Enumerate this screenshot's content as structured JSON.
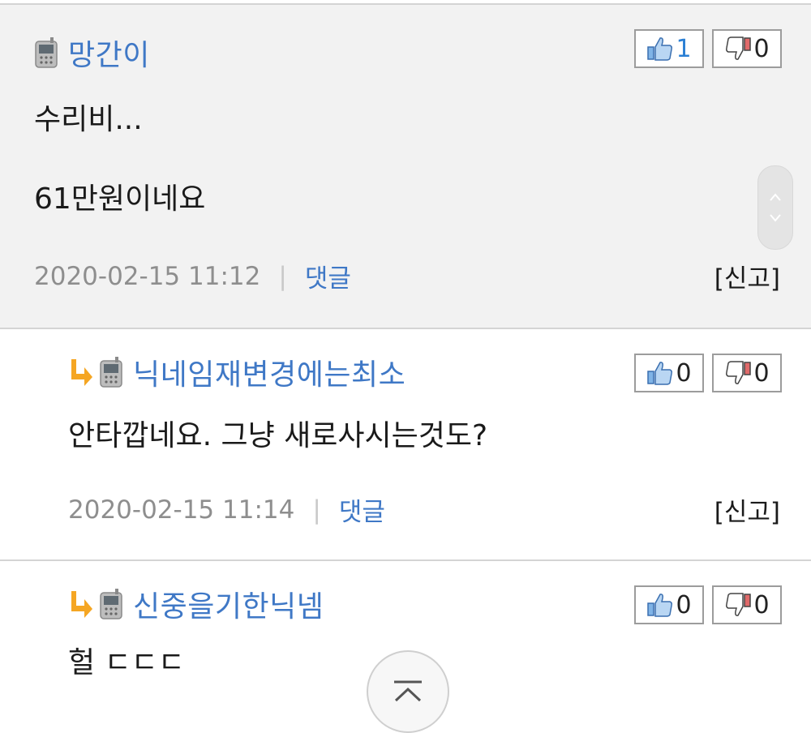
{
  "comments": [
    {
      "nickname": "망간이",
      "lines": [
        "수리비...",
        "61만원이네요"
      ],
      "date": "2020-02-15 11:12",
      "separator": "|",
      "reply_label": "댓글",
      "report_label": "[신고]",
      "likes": "1",
      "dislikes": "0"
    },
    {
      "nickname": "닉네임재변경에는최소",
      "lines": [
        "안타깝네요. 그냥 새로사시는것도?"
      ],
      "date": "2020-02-15 11:14",
      "separator": "|",
      "reply_label": "댓글",
      "report_label": "[신고]",
      "likes": "0",
      "dislikes": "0"
    },
    {
      "nickname": "신중을기한닉넴",
      "lines": [
        "헐 ㄷㄷㄷ"
      ],
      "likes": "0",
      "dislikes": "0"
    }
  ],
  "icons": {
    "device": "mobile-phone-icon",
    "reply": "reply-arrow-icon",
    "like": "thumbs-up-icon",
    "dislike": "thumbs-down-icon",
    "scroll_top": "scroll-to-top-icon"
  },
  "colors": {
    "nickname": "#3f78c6",
    "like_count_active": "#2a7fd4",
    "date": "#8e8e8e",
    "highlight_bg": "#f2f2f2"
  }
}
